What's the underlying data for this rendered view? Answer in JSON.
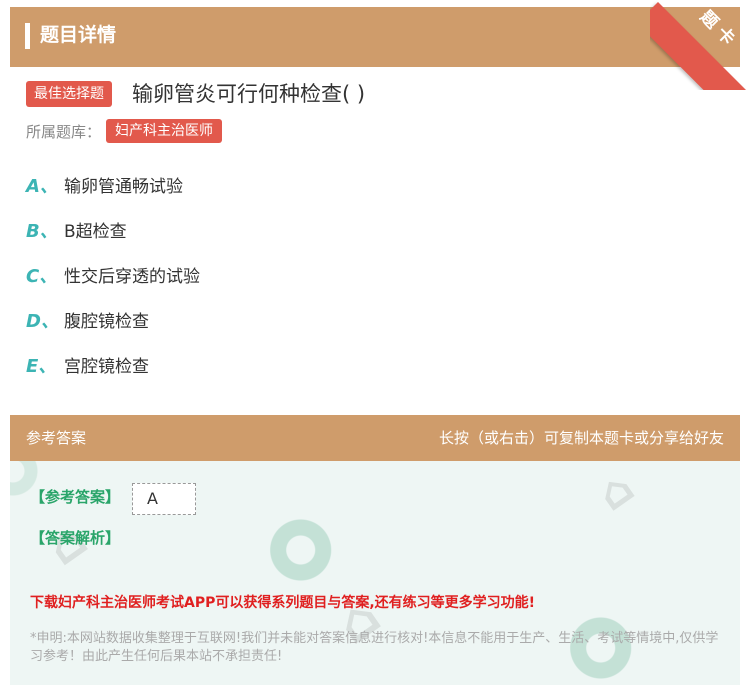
{
  "header": {
    "title": "题目详情"
  },
  "ribbon": {
    "label": "题卡"
  },
  "question": {
    "type_tag": "最佳选择题",
    "text": "输卵管炎可行何种检查( )",
    "bank_label": "所属题库：",
    "bank_tag": "妇产科主治医师"
  },
  "options": [
    {
      "letter": "A、",
      "text": "输卵管通畅试验"
    },
    {
      "letter": "B、",
      "text": "B超检查"
    },
    {
      "letter": "C、",
      "text": "性交后穿透的试验"
    },
    {
      "letter": "D、",
      "text": "腹腔镜检查"
    },
    {
      "letter": "E、",
      "text": "宫腔镜检查"
    }
  ],
  "answer_section": {
    "header_left": "参考答案",
    "header_right": "长按（或右击）可复制本题卡或分享给好友",
    "answer_label": "【参考答案】",
    "answer_value": "A",
    "analysis_label": "【答案解析】",
    "promo": "下载妇产科主治医师考试APP可以获得系列题目与答案,还有练习等更多学习功能!",
    "declaration": "*申明:本网站数据收集整理于互联网!我们并未能对答案信息进行核对!本信息不能用于生产、生活、考试等情境中,仅供学习参考！由此产生任何后果本站不承担责任!"
  },
  "colors": {
    "accent": "#cf9c6b",
    "tag": "#e2594c",
    "option_letter": "#3cb4b4",
    "answer_label": "#2aa56a",
    "promo": "#e02020"
  }
}
